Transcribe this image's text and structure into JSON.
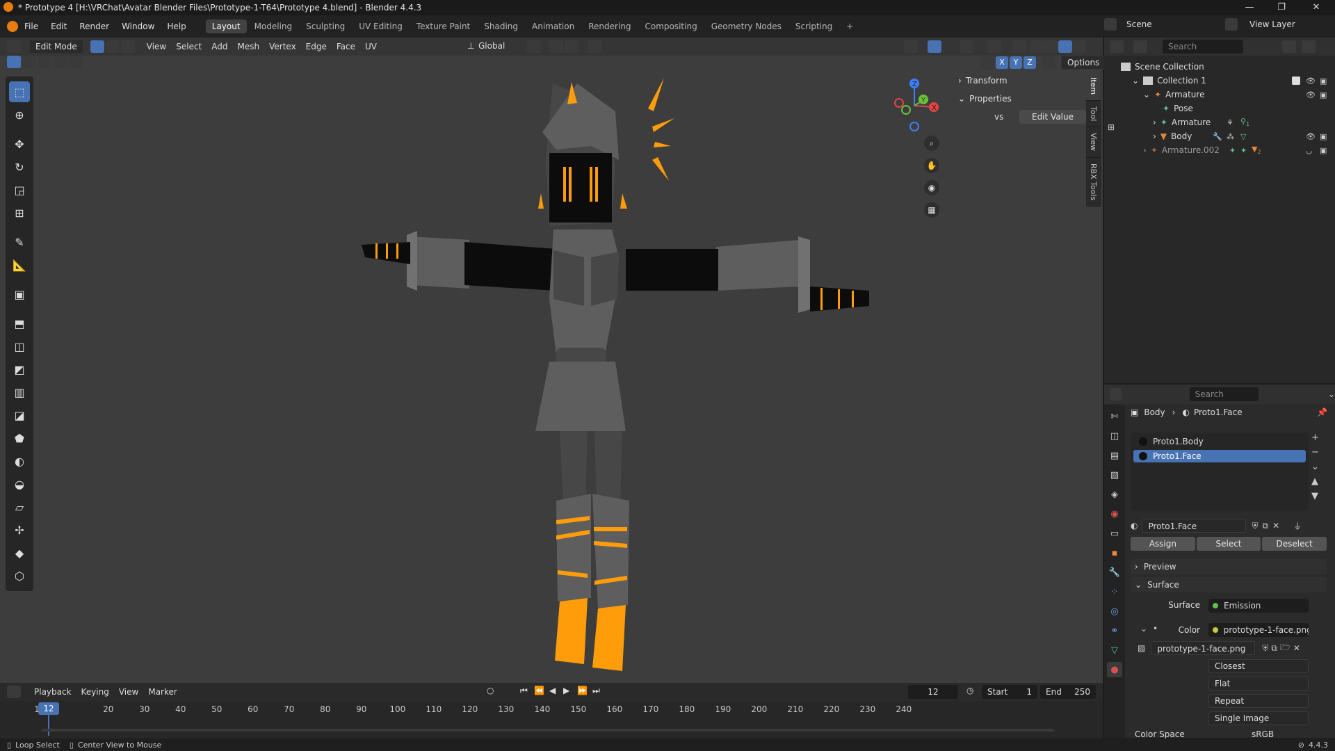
{
  "window": {
    "title": "* Prototype 4 [H:\\VRChat\\Avatar Blender Files\\Prototype-1-T64\\Prototype 4.blend] - Blender 4.4.3",
    "controls": [
      "—",
      "❐",
      "✕"
    ]
  },
  "menu": [
    "File",
    "Edit",
    "Render",
    "Window",
    "Help"
  ],
  "workspaces": [
    "Layout",
    "Modeling",
    "Sculpting",
    "UV Editing",
    "Texture Paint",
    "Shading",
    "Animation",
    "Rendering",
    "Compositing",
    "Geometry Nodes",
    "Scripting"
  ],
  "active_workspace": "Layout",
  "scene": {
    "label": "Scene",
    "view_layer": "View Layer"
  },
  "viewport": {
    "mode": "Edit Mode",
    "menus": [
      "View",
      "Select",
      "Add",
      "Mesh",
      "Vertex",
      "Edge",
      "Face",
      "UV"
    ],
    "orientation": "Global",
    "options_label": "Options",
    "axis_labels": [
      "X",
      "Y",
      "Z"
    ],
    "gizmo_axes": {
      "x": "X",
      "y": "Y",
      "z": "Z"
    },
    "npanel": {
      "transform": "Transform",
      "properties": "Properties",
      "prop_key": "vs",
      "prop_button": "Edit Value",
      "tabs": [
        "Item",
        "Tool",
        "View",
        "RBX Tools"
      ]
    }
  },
  "outliner": {
    "search_placeholder": "Search",
    "items": [
      {
        "label": "Scene Collection"
      },
      {
        "label": "Collection 1"
      },
      {
        "label": "Armature"
      },
      {
        "label": "Pose"
      },
      {
        "label": "Armature"
      },
      {
        "label": "Body"
      },
      {
        "label": "Armature.002",
        "badge": "2"
      }
    ],
    "armature_child_badge": "1"
  },
  "properties": {
    "search_placeholder": "Search",
    "breadcrumb": [
      "Body",
      "Proto1.Face"
    ],
    "material_slots": [
      "Proto1.Body",
      "Proto1.Face"
    ],
    "active_slot": 1,
    "material_name": "Proto1.Face",
    "buttons": [
      "Assign",
      "Select",
      "Deselect"
    ],
    "preview": "Preview",
    "surface_panel": "Surface",
    "surface_label": "Surface",
    "surface_value": "Emission",
    "color_label": "Color",
    "color_value": "prototype-1-face.png",
    "image_name": "prototype-1-face.png",
    "interpolation": "Closest",
    "projection": "Flat",
    "extension": "Repeat",
    "source": "Single Image",
    "color_space_label": "Color Space",
    "color_space_value": "sRGB"
  },
  "timeline": {
    "menus": [
      "Playback",
      "Keying",
      "View",
      "Marker"
    ],
    "current_frame": "12",
    "start_label": "Start",
    "start": "1",
    "end_label": "End",
    "end": "250",
    "ticks": [
      "1",
      "20",
      "30",
      "40",
      "50",
      "60",
      "70",
      "80",
      "90",
      "100",
      "110",
      "120",
      "130",
      "140",
      "150",
      "160",
      "170",
      "180",
      "190",
      "200",
      "210",
      "220",
      "230",
      "240"
    ]
  },
  "status": {
    "left": "Loop Select",
    "mid": "Center View to Mouse",
    "version": "4.4.3"
  },
  "colors": {
    "accent": "#4772b3",
    "emission": "#ff9c0a",
    "viewport_bg": "#3d3d3d"
  }
}
